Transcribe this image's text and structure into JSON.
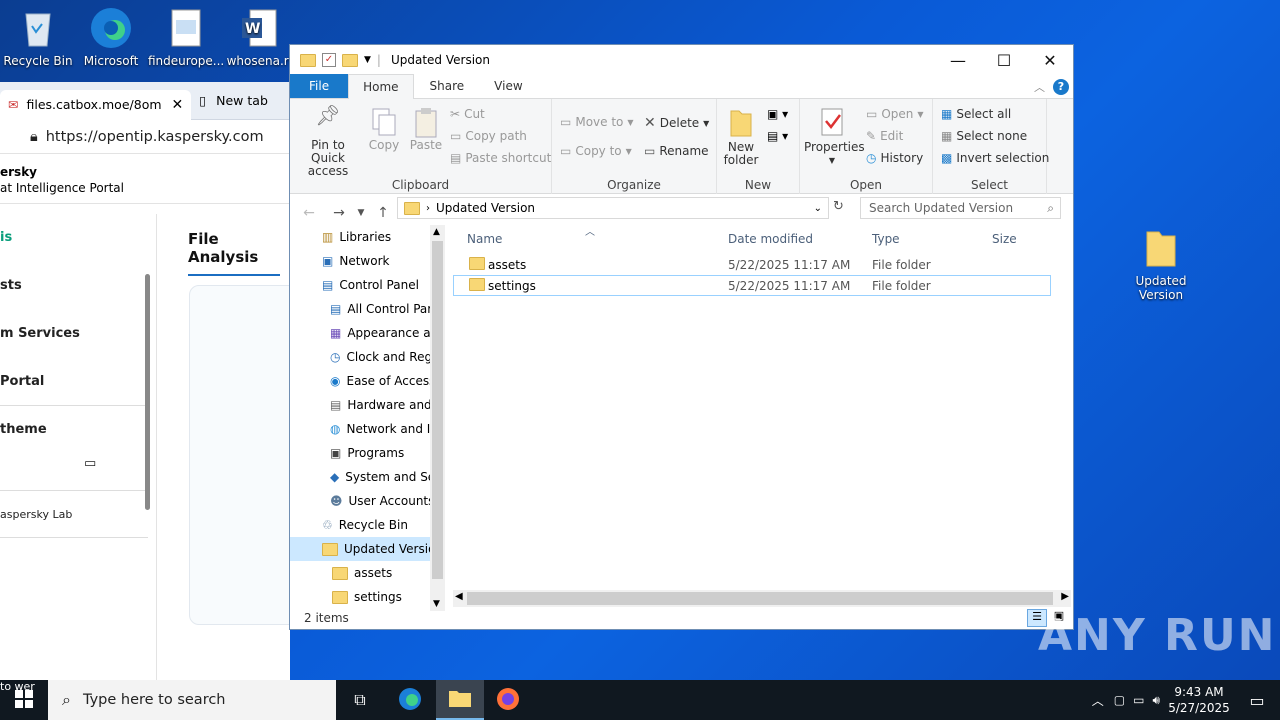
{
  "desktop": {
    "icons": [
      {
        "label": "Recycle Bin"
      },
      {
        "label": "Microsoft"
      },
      {
        "label": "findeurope..."
      },
      {
        "label": "whosena.rt"
      },
      {
        "label": "Updated Version"
      }
    ]
  },
  "browser": {
    "tab1": "files.catbox.moe/8om",
    "tab2": "New tab",
    "url": "https://opentip.kaspersky.com",
    "brand1": "ersky",
    "brand2": "at Intelligence Portal",
    "nav": [
      "is",
      "sts",
      "m Services",
      "Portal",
      "theme"
    ],
    "footer": "aspersky Lab",
    "heading": "File Analysis"
  },
  "explorer": {
    "title": "Updated Version",
    "tabs": {
      "file": "File",
      "home": "Home",
      "share": "Share",
      "view": "View"
    },
    "ribbon": {
      "pin": "Pin to Quick access",
      "copy": "Copy",
      "paste": "Paste",
      "cut": "Cut",
      "copy_path": "Copy path",
      "paste_shortcut": "Paste shortcut",
      "clipboard": "Clipboard",
      "move_to": "Move to",
      "copy_to": "Copy to",
      "delete": "Delete",
      "rename": "Rename",
      "organize": "Organize",
      "new_folder": "New folder",
      "new": "New",
      "properties": "Properties",
      "open": "Open",
      "edit": "Edit",
      "history": "History",
      "open_group": "Open",
      "select_all": "Select all",
      "select_none": "Select none",
      "invert_selection": "Invert selection",
      "select": "Select"
    },
    "path": "Updated Version",
    "search_placeholder": "Search Updated Version",
    "nav_items": [
      {
        "label": "Libraries"
      },
      {
        "label": "Network"
      },
      {
        "label": "Control Panel"
      },
      {
        "label": "All Control Par"
      },
      {
        "label": "Appearance an"
      },
      {
        "label": "Clock and Regi"
      },
      {
        "label": "Ease of Access"
      },
      {
        "label": "Hardware and"
      },
      {
        "label": "Network and Ir"
      },
      {
        "label": "Programs"
      },
      {
        "label": "System and Sec"
      },
      {
        "label": "User Accounts"
      },
      {
        "label": "Recycle Bin"
      },
      {
        "label": "Updated Version"
      },
      {
        "label": "assets"
      },
      {
        "label": "settings"
      }
    ],
    "columns": {
      "name": "Name",
      "date": "Date modified",
      "type": "Type",
      "size": "Size"
    },
    "files": [
      {
        "name": "assets",
        "date": "5/22/2025 11:17 AM",
        "type": "File folder"
      },
      {
        "name": "settings",
        "date": "5/22/2025 11:17 AM",
        "type": "File folder"
      }
    ],
    "status": "2 items"
  },
  "taskbar": {
    "search_placeholder": "Type here to search",
    "time": "9:43 AM",
    "date": "5/27/2025",
    "left_text": "to wer"
  },
  "watermark": "ANY RUN"
}
